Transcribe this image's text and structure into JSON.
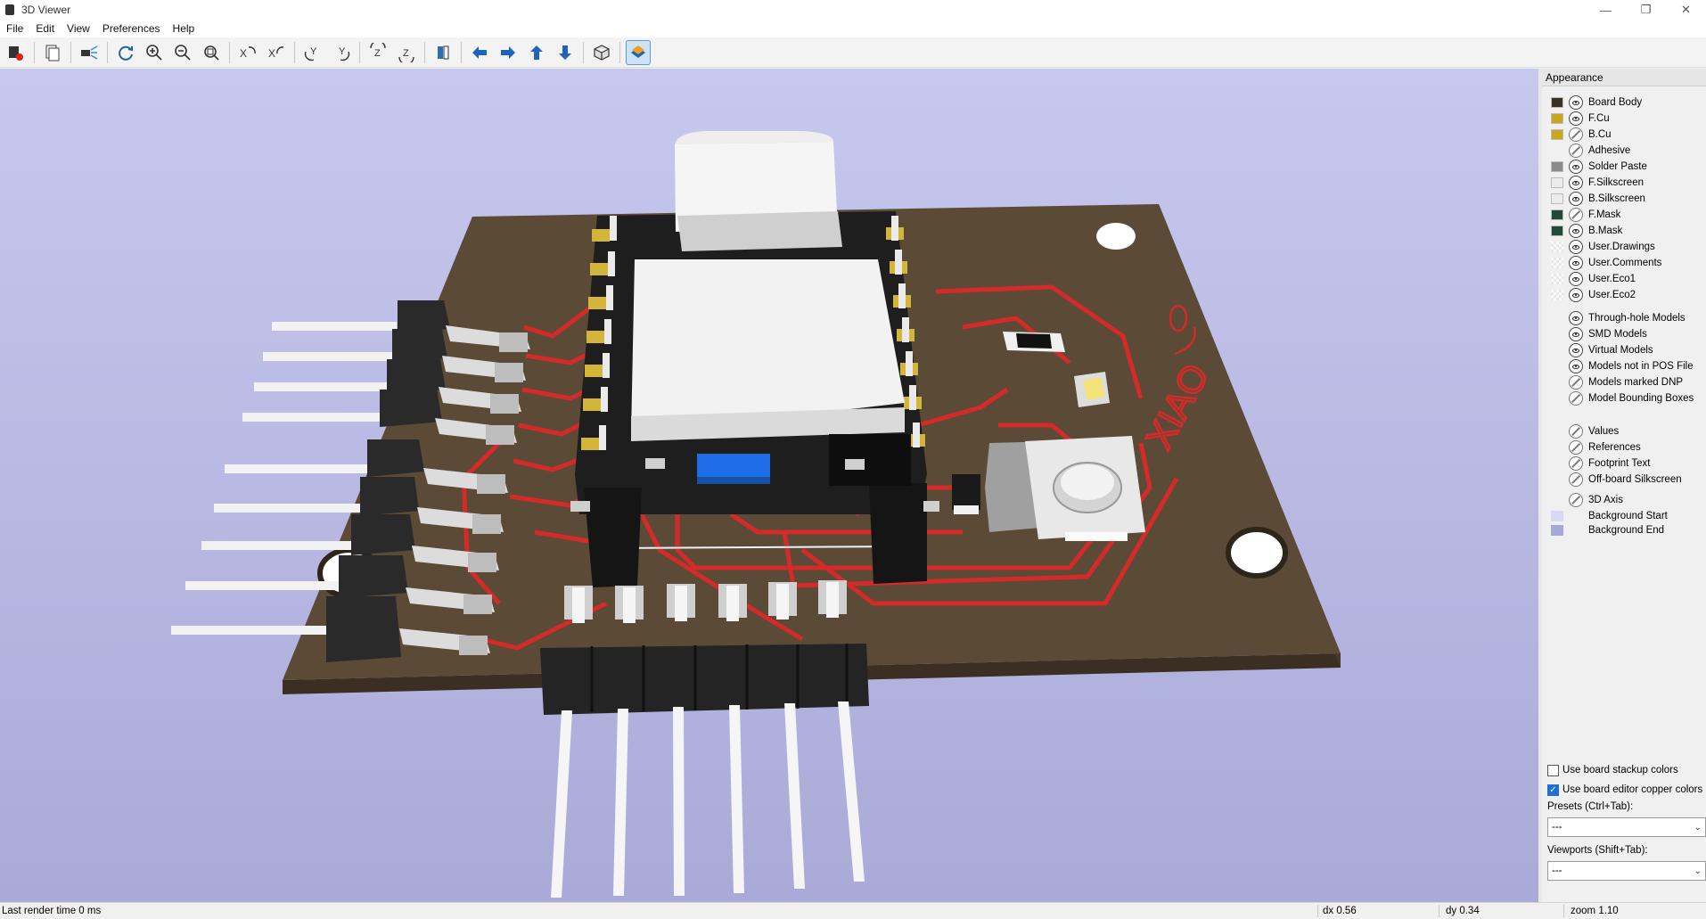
{
  "window": {
    "title": "3D Viewer",
    "controls": [
      "minimize",
      "restore",
      "close"
    ]
  },
  "menu": [
    "File",
    "Edit",
    "View",
    "Preferences",
    "Help"
  ],
  "toolbar": {
    "buttons": [
      {
        "name": "render-options-icon"
      },
      {
        "name": "copy-image-icon"
      },
      {
        "name": "raytrace-icon"
      },
      {
        "name": "reload-icon"
      },
      {
        "name": "zoom-in-icon"
      },
      {
        "name": "zoom-out-icon"
      },
      {
        "name": "zoom-fit-icon"
      },
      {
        "name": "rotate-x-cw-icon"
      },
      {
        "name": "rotate-x-ccw-icon"
      },
      {
        "name": "rotate-y-cw-icon"
      },
      {
        "name": "rotate-y-ccw-icon"
      },
      {
        "name": "rotate-z-cw-icon"
      },
      {
        "name": "rotate-z-ccw-icon"
      },
      {
        "name": "flip-board-icon"
      },
      {
        "name": "move-left-icon"
      },
      {
        "name": "move-right-icon"
      },
      {
        "name": "move-up-icon"
      },
      {
        "name": "move-down-icon"
      },
      {
        "name": "orthographic-icon"
      },
      {
        "name": "layers-manager-icon",
        "active": true
      }
    ]
  },
  "scene": {
    "silkscreen_text": "XIAO",
    "colors": {
      "board": "#5a4a36",
      "copper_trace": "#d42a2a",
      "mask": "#2e4d3f",
      "component_body": "#1e1e1e",
      "pad_gold": "#d4b53c",
      "pin_white": "#f2f2f2",
      "usb_blue": "#1d6ee6"
    }
  },
  "appearance": {
    "title": "Appearance",
    "layers": [
      {
        "label": "Board Body",
        "color": "#3b3123",
        "visible": true
      },
      {
        "label": "F.Cu",
        "color": "#c8a620",
        "visible": true
      },
      {
        "label": "B.Cu",
        "color": "#c8a620",
        "visible": false
      },
      {
        "label": "Adhesive",
        "color": "",
        "visible": false
      },
      {
        "label": "Solder Paste",
        "color": "#8a8a8a",
        "visible": true
      },
      {
        "label": "F.Silkscreen",
        "color": "#ececec",
        "visible": true
      },
      {
        "label": "B.Silkscreen",
        "color": "#ececec",
        "visible": true
      },
      {
        "label": "F.Mask",
        "color": "#224a38",
        "visible": false
      },
      {
        "label": "B.Mask",
        "color": "#224a38",
        "visible": true
      },
      {
        "label": "User.Drawings",
        "color": "checker",
        "visible": true
      },
      {
        "label": "User.Comments",
        "color": "checker",
        "visible": true
      },
      {
        "label": "User.Eco1",
        "color": "checker",
        "visible": true
      },
      {
        "label": "User.Eco2",
        "color": "checker",
        "visible": true
      }
    ],
    "objects": [
      {
        "label": "Through-hole Models",
        "visible": true
      },
      {
        "label": "SMD Models",
        "visible": true
      },
      {
        "label": "Virtual Models",
        "visible": true
      },
      {
        "label": "Models not in POS File",
        "visible": true
      },
      {
        "label": "Models marked DNP",
        "visible": false
      },
      {
        "label": "Model Bounding Boxes",
        "visible": false
      }
    ],
    "texts": [
      {
        "label": "Values",
        "visible": false
      },
      {
        "label": "References",
        "visible": false
      },
      {
        "label": "Footprint Text",
        "visible": false
      },
      {
        "label": "Off-board Silkscreen",
        "visible": false
      }
    ],
    "axis": {
      "label": "3D Axis",
      "visible": false
    },
    "backgrounds": [
      {
        "label": "Background Start",
        "color": "#d8d8f2"
      },
      {
        "label": "Background End",
        "color": "#a8a8d8"
      }
    ],
    "options": [
      {
        "label": "Use board stackup colors",
        "checked": false
      },
      {
        "label": "Use board editor copper colors",
        "checked": true
      }
    ],
    "presets_label": "Presets (Ctrl+Tab):",
    "presets_value": "---",
    "viewports_label": "Viewports (Shift+Tab):",
    "viewports_value": "---"
  },
  "status": {
    "render_time": "Last render time 0 ms",
    "dx": "dx 0.56",
    "dy": "dy 0.34",
    "zoom": "zoom 1.10"
  }
}
